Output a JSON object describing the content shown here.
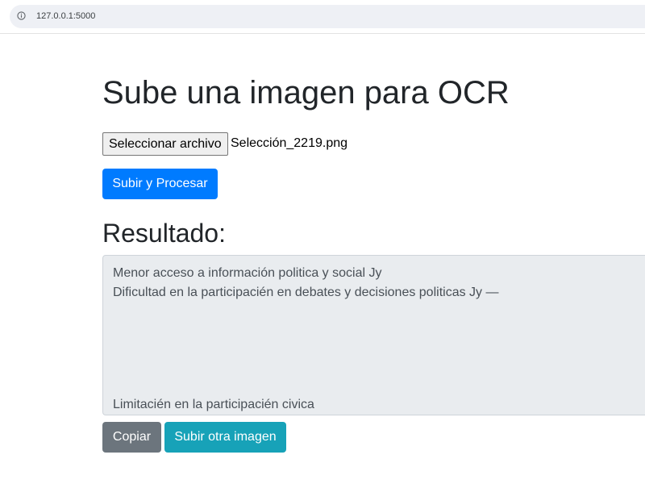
{
  "browser": {
    "url": "127.0.0.1:5000",
    "info_icon": "info-circle-icon"
  },
  "page": {
    "title": "Sube una imagen para OCR",
    "file_input": {
      "button_label": "Seleccionar archivo",
      "file_name": "Selección_2219.png"
    },
    "submit_label": "Subir y Procesar",
    "result_title": "Resultado:",
    "result_lines": [
      "Menor acceso a información politica y social Jy",
      "Dificultad en la participacién en debates y decisiones politicas Jy —",
      "Limitacién en la participacién civica"
    ],
    "copy_label": "Copiar",
    "upload_another_label": "Subir otra imagen"
  },
  "colors": {
    "primary": "#007bff",
    "secondary": "#6c757d",
    "info": "#17a2b8",
    "result_bg": "#e9ecef"
  }
}
